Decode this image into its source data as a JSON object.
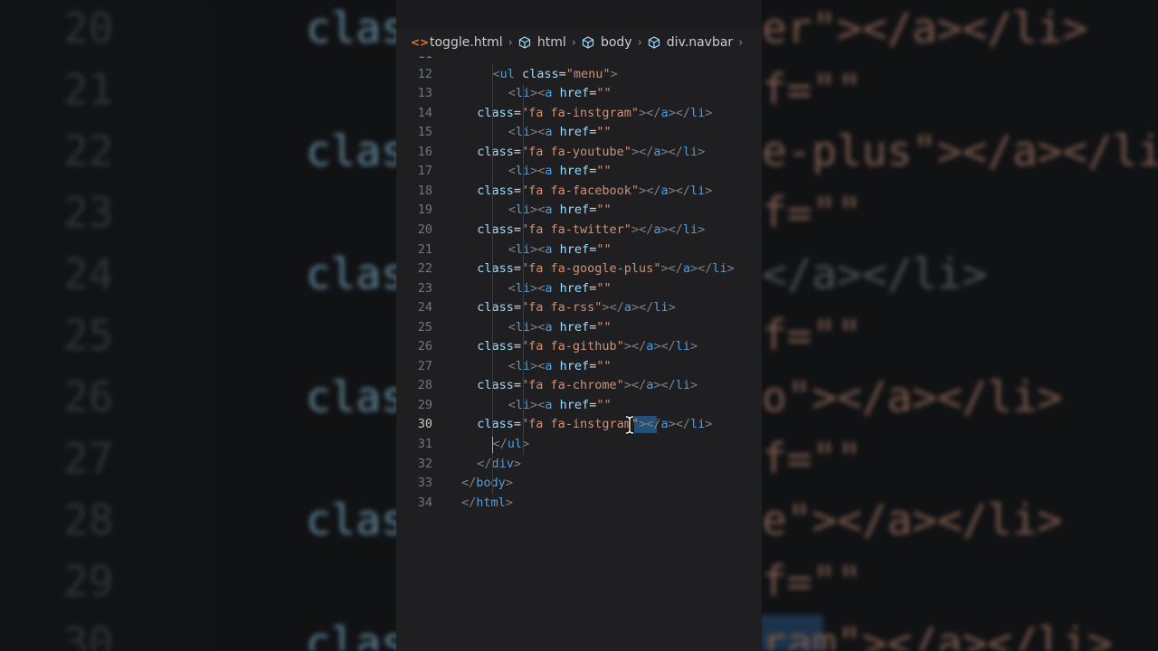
{
  "breadcrumb": {
    "items": [
      {
        "label": "toggle.html",
        "icon": "html-file-icon"
      },
      {
        "label": "html",
        "icon": "cube-icon"
      },
      {
        "label": "body",
        "icon": "cube-icon"
      },
      {
        "label": "div.navbar",
        "icon": "cube-icon"
      }
    ]
  },
  "editor": {
    "active_line": "30",
    "partial_top_line": "<div class=\"navbar\">",
    "lines": [
      {
        "num": "11",
        "text": "<div class=\"navbar\">"
      },
      {
        "num": "12",
        "text": "<ul class=\"menu\">"
      },
      {
        "num": "13",
        "text": "<li><a href=\"\""
      },
      {
        "num": "14",
        "text": "class=\"fa fa-instgram\"></a></li>"
      },
      {
        "num": "15",
        "text": "<li><a href=\"\""
      },
      {
        "num": "16",
        "text": "class=\"fa fa-youtube\"></a></li>"
      },
      {
        "num": "17",
        "text": "<li><a href=\"\""
      },
      {
        "num": "18",
        "text": "class=\"fa fa-facebook\"></a></li>"
      },
      {
        "num": "19",
        "text": "<li><a href=\"\""
      },
      {
        "num": "20",
        "text": "class=\"fa fa-twitter\"></a></li>"
      },
      {
        "num": "21",
        "text": "<li><a href=\"\""
      },
      {
        "num": "22",
        "text": "class=\"fa fa-google-plus\"></a></li>"
      },
      {
        "num": "23",
        "text": "<li><a href=\"\""
      },
      {
        "num": "24",
        "text": "class=\"fa fa-rss\"></a></li>"
      },
      {
        "num": "25",
        "text": "<li><a href=\"\""
      },
      {
        "num": "26",
        "text": "class=\"fa fa-github\"></a></li>"
      },
      {
        "num": "27",
        "text": "<li><a href=\"\""
      },
      {
        "num": "28",
        "text": "class=\"fa fa-chrome\"></a></li>"
      },
      {
        "num": "29",
        "text": "<li><a href=\"\""
      },
      {
        "num": "30",
        "text": "class=\"fa fa-instgram\"></a></li>"
      },
      {
        "num": "31",
        "text": "</ul>"
      },
      {
        "num": "32",
        "text": "</div>"
      },
      {
        "num": "33",
        "text": "</body>"
      },
      {
        "num": "34",
        "text": "</html>"
      }
    ],
    "selected_text": "ram"
  },
  "background_blur": {
    "line_numbers": [
      "20",
      "21",
      "22",
      "23",
      "24",
      "25",
      "26",
      "27",
      "28",
      "29",
      "30"
    ],
    "fragments": [
      "clas",
      "er\"></a></li>",
      "f=\"\"",
      "e-plus\"></a></li",
      "</a></li>",
      "o\"></a></li>",
      "e\"></a></li>",
      "ram\"></a></li>"
    ]
  },
  "colors": {
    "panel_bg": "#1f1f22",
    "tag_name": "#569cd6",
    "attribute": "#9cdcfe",
    "string": "#ce9178",
    "bracket": "#808080",
    "selection": "#264f78",
    "file_icon": "#e37933"
  }
}
